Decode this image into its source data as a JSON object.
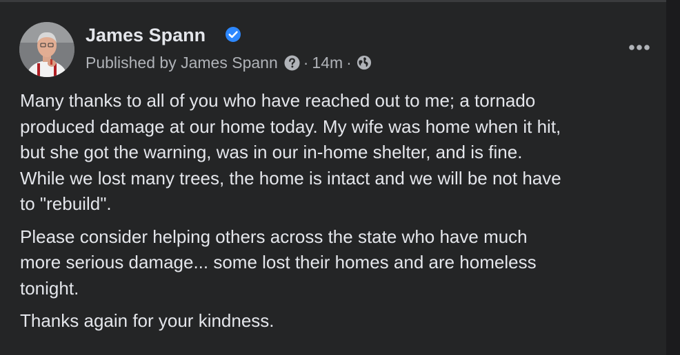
{
  "post": {
    "author": {
      "name": "James Spann",
      "verified": true,
      "avatar_icon": "avatar-photo"
    },
    "meta": {
      "published_by": "Published by James Spann",
      "time": "14m",
      "separator": "·",
      "audience_icon": "globe-icon",
      "info_icon": "question-icon"
    },
    "more_icon": "more-dots-icon",
    "paragraphs": [
      "Many thanks to all of you who have reached out to me; a tornado\nproduced damage at our home today. My wife was home when it hit,\nbut she got the warning, was in our in-home shelter, and is fine.\nWhile we lost many trees, the home is intact and we will be not have\nto \"rebuild\".",
      "Please consider helping others across the state who have much\nmore serious damage... some lost their homes and are homeless\ntonight.",
      "Thanks again for your kindness."
    ]
  },
  "colors": {
    "background": "#242526",
    "text_primary": "#e4e6eb",
    "text_secondary": "#b0b3b8",
    "verified_blue": "#2d88ff"
  }
}
